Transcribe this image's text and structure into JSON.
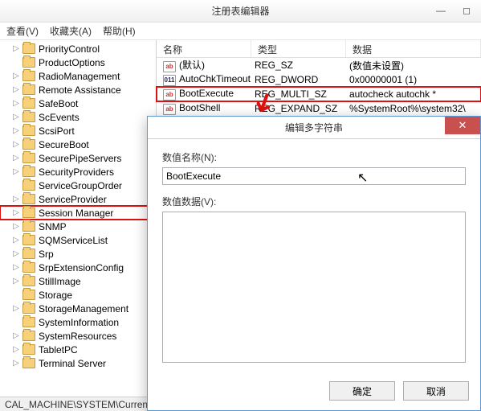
{
  "window": {
    "title": "注册表编辑器"
  },
  "menu": {
    "view": "查看(V)",
    "fav": "收藏夹(A)",
    "help": "帮助(H)"
  },
  "tree": {
    "items": [
      {
        "label": "PriorityControl",
        "exp": "▷"
      },
      {
        "label": "ProductOptions",
        "exp": ""
      },
      {
        "label": "RadioManagement",
        "exp": "▷"
      },
      {
        "label": "Remote Assistance",
        "exp": "▷"
      },
      {
        "label": "SafeBoot",
        "exp": "▷"
      },
      {
        "label": "ScEvents",
        "exp": "▷"
      },
      {
        "label": "ScsiPort",
        "exp": "▷"
      },
      {
        "label": "SecureBoot",
        "exp": "▷"
      },
      {
        "label": "SecurePipeServers",
        "exp": "▷"
      },
      {
        "label": "SecurityProviders",
        "exp": "▷"
      },
      {
        "label": "ServiceGroupOrder",
        "exp": ""
      },
      {
        "label": "ServiceProvider",
        "exp": "▷"
      },
      {
        "label": "Session Manager",
        "exp": "▷",
        "hl": true
      },
      {
        "label": "SNMP",
        "exp": "▷"
      },
      {
        "label": "SQMServiceList",
        "exp": "▷"
      },
      {
        "label": "Srp",
        "exp": "▷"
      },
      {
        "label": "SrpExtensionConfig",
        "exp": "▷"
      },
      {
        "label": "StillImage",
        "exp": "▷"
      },
      {
        "label": "Storage",
        "exp": ""
      },
      {
        "label": "StorageManagement",
        "exp": "▷"
      },
      {
        "label": "SystemInformation",
        "exp": ""
      },
      {
        "label": "SystemResources",
        "exp": "▷"
      },
      {
        "label": "TabletPC",
        "exp": "▷"
      },
      {
        "label": "Terminal Server",
        "exp": "▷"
      }
    ]
  },
  "list": {
    "headers": {
      "name": "名称",
      "type": "类型",
      "data": "数据"
    },
    "rows": [
      {
        "icon": "ab",
        "name": "(默认)",
        "type": "REG_SZ",
        "data": "(数值未设置)"
      },
      {
        "icon": "bin",
        "name": "AutoChkTimeout",
        "type": "REG_DWORD",
        "data": "0x00000001 (1)"
      },
      {
        "icon": "ab",
        "name": "BootExecute",
        "type": "REG_MULTI_SZ",
        "data": "autocheck autochk *",
        "hl": true
      },
      {
        "icon": "ab",
        "name": "BootShell",
        "type": "REG_EXPAND_SZ",
        "data": "%SystemRoot%\\system32\\"
      }
    ]
  },
  "status": {
    "path": "CAL_MACHINE\\SYSTEM\\Current"
  },
  "dialog": {
    "title": "编辑多字符串",
    "name_label": "数值名称(N):",
    "name_value": "BootExecute",
    "data_label": "数值数据(V):",
    "data_value": "",
    "ok": "确定",
    "cancel": "取消"
  }
}
